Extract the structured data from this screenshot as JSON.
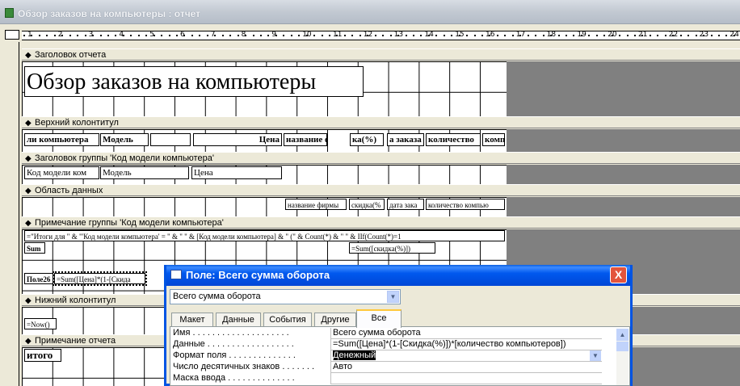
{
  "window": {
    "title": "Обзор заказов на компьютеры : отчет"
  },
  "ruler": {
    "numbers": [
      "1",
      "2",
      "3",
      "4",
      "5",
      "6",
      "7",
      "8",
      "9",
      "10",
      "11",
      "12",
      "13",
      "14",
      "15",
      "16",
      "17",
      "18",
      "19",
      "20",
      "21",
      "22",
      "23",
      "24"
    ]
  },
  "sections": {
    "report_header": {
      "label": "Заголовок отчета",
      "title_text": "Обзор заказов на компьютеры"
    },
    "page_header": {
      "label": "Верхний колонтитул",
      "fields": [
        "ли компьютера",
        "Модель",
        "Цена",
        "название фи",
        "ка(%)",
        "а заказа",
        "количество",
        "комп"
      ]
    },
    "group_header": {
      "label": "Заголовок группы 'Код модели компьютера'",
      "fields": [
        "Код модели ком",
        "Модель",
        "Цена"
      ]
    },
    "detail": {
      "label": "Область данных",
      "fields": [
        "название фирмы",
        "скидка(%",
        "дата зака",
        "количество компью"
      ]
    },
    "group_footer": {
      "label": "Примечание группы 'Код модели компьютера'",
      "expression": "=\"Итоги для \" & \"'Код модели компьютера' = \" & \" \" & [Код модели компьютера] & \" (\" & Count(*) & \" \" & IIf(Count(*)=1",
      "sum_label": "Sum",
      "sum_expr": "=Sum([скидка(%)])",
      "field_label": "Поле26",
      "field_expr": "=Sum([Цена]*(1-[Скида"
    },
    "page_footer": {
      "label": "Нижний колонтитул",
      "now_expr": "=Now()"
    },
    "report_footer": {
      "label": "Примечание отчета",
      "total_label": "итого"
    }
  },
  "dialog": {
    "title": "Поле: Всего сумма оборота",
    "object_select": "Всего сумма оборота",
    "close_label": "X",
    "tabs": [
      "Макет",
      "Данные",
      "События",
      "Другие",
      "Все"
    ],
    "active_tab": "Все",
    "properties": [
      {
        "name": "Имя . . . . . . . . . . . . . . . . . . . .",
        "value": "Всего сумма оборота"
      },
      {
        "name": "Данные . . . . . . . . . . . . . . . . . .",
        "value": "=Sum([Цена]*(1-[Скидка(%)])*[количество компьютеров])"
      },
      {
        "name": "Формат поля . . . . . . . . . . . . . .",
        "value": "Денежный"
      },
      {
        "name": "Число десятичных знаков . . . . . . .",
        "value": "Авто"
      },
      {
        "name": "Маска ввода . . . . . . . . . . . . . .",
        "value": ""
      }
    ]
  },
  "colors": {
    "title_blue": "#0054e3",
    "grid": "#000000",
    "background": "#808080",
    "panel": "#ece9d8"
  }
}
